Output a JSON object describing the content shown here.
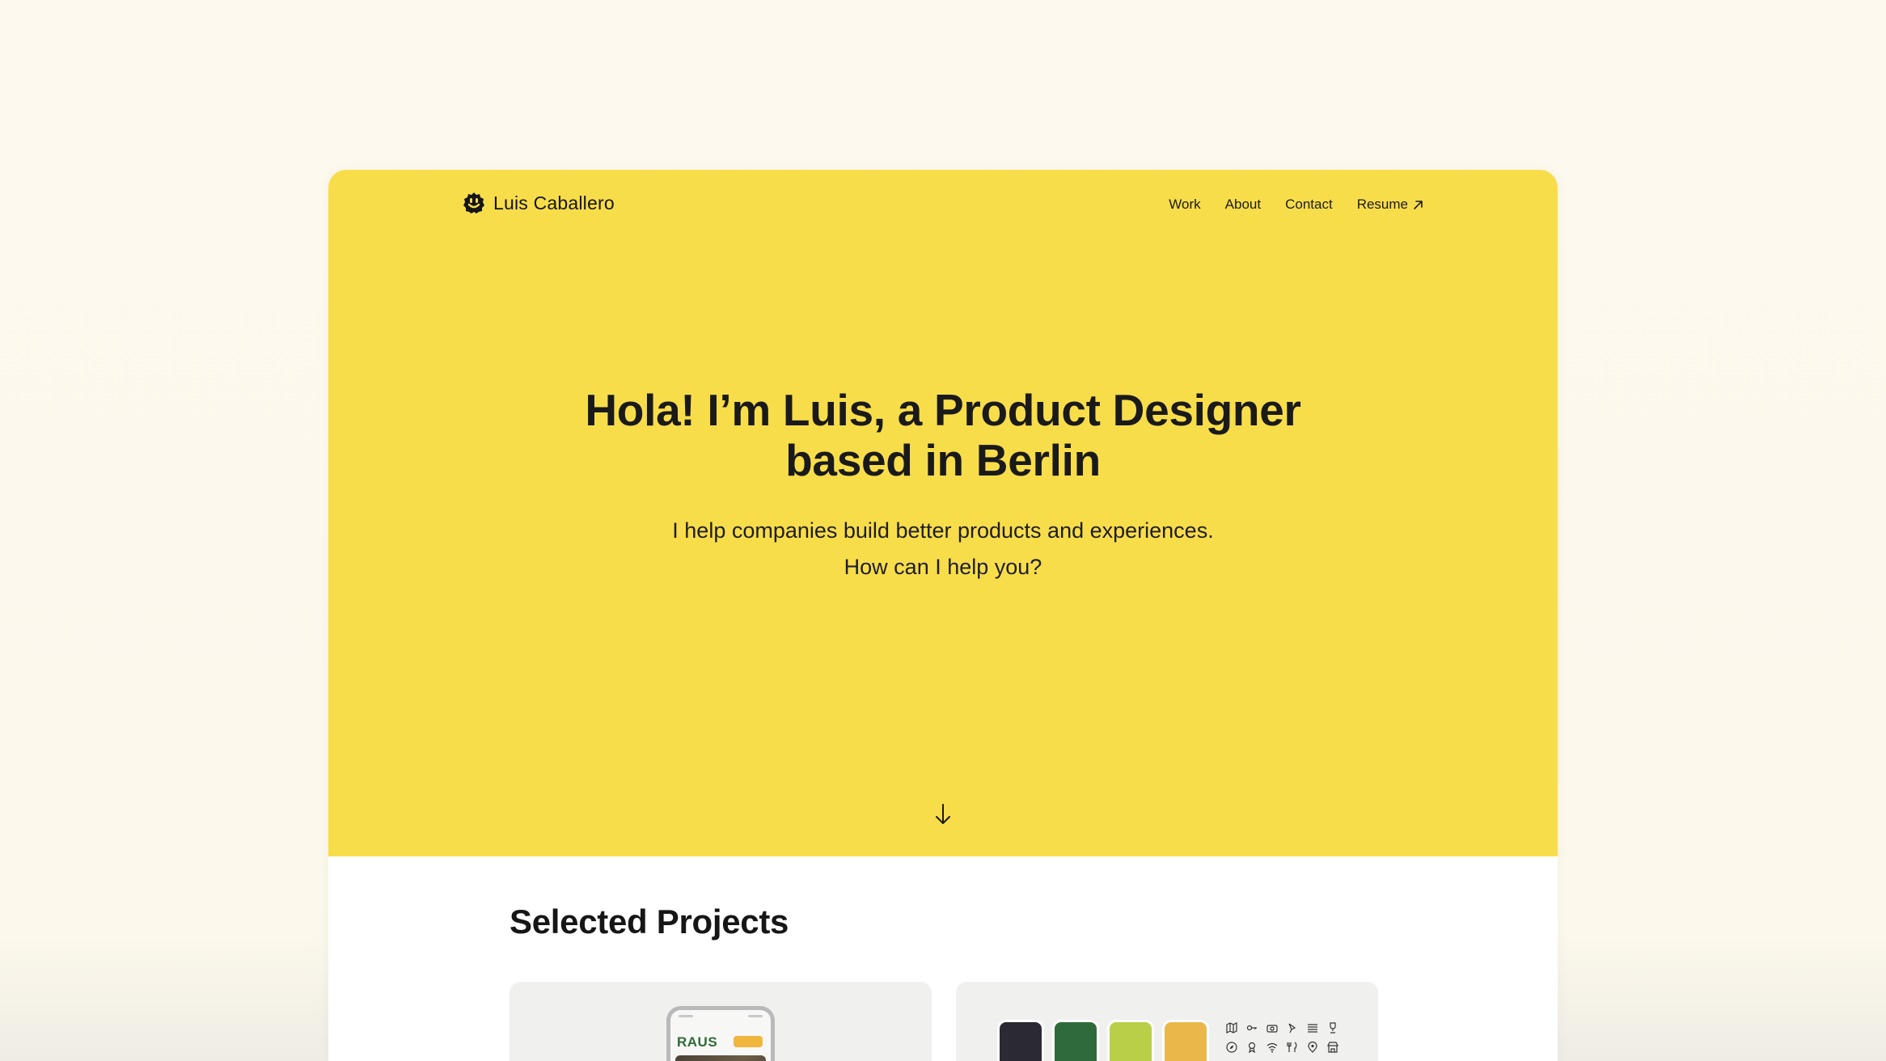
{
  "brand": {
    "name": "Luis Caballero",
    "logo_icon": "smiley-face-icon"
  },
  "nav": {
    "items": [
      {
        "label": "Work"
      },
      {
        "label": "About"
      },
      {
        "label": "Contact"
      },
      {
        "label": "Resume",
        "icon": "arrow-up-right-icon"
      }
    ]
  },
  "hero": {
    "headline_line1": "Hola! I’m Luis, a Product Designer",
    "headline_line2": "based in Berlin",
    "subline_line1": "I help companies build better products and experiences.",
    "subline_line2": "How can I help you?",
    "scroll_icon": "arrow-down-icon",
    "background": "#f8dd4b"
  },
  "projects": {
    "title": "Selected Projects",
    "cards": [
      {
        "preview_text": "RAUS",
        "preview_icon": "phone-mockup"
      },
      {
        "swatches": [
          "#2b2a33",
          "#2f6b3a",
          "#b9cf47",
          "#eab84a"
        ],
        "preview_icon": "icon-set"
      }
    ]
  },
  "colors": {
    "page_background": "#fdf8ec",
    "accent_yellow": "#f8dd4b",
    "text": "#1a1a1a"
  }
}
